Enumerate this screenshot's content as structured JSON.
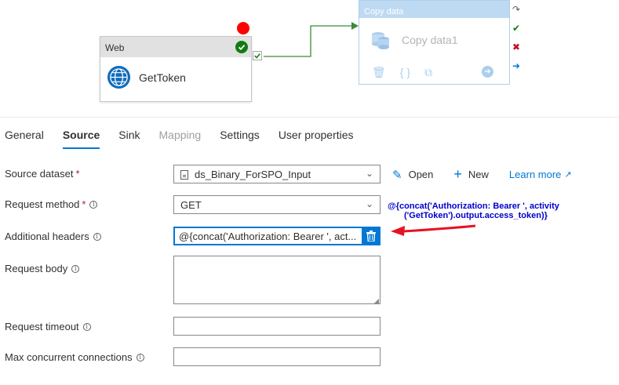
{
  "canvas": {
    "web_activity": {
      "type_label": "Web",
      "name": "GetToken"
    },
    "copy_activity": {
      "type_label": "Copy data",
      "name": "Copy data1"
    }
  },
  "tabs": [
    {
      "label": "General",
      "state": "normal"
    },
    {
      "label": "Source",
      "state": "active"
    },
    {
      "label": "Sink",
      "state": "normal"
    },
    {
      "label": "Mapping",
      "state": "disabled"
    },
    {
      "label": "Settings",
      "state": "normal"
    },
    {
      "label": "User properties",
      "state": "normal"
    }
  ],
  "form": {
    "source_dataset": {
      "label": "Source dataset",
      "required": "*",
      "value": "ds_Binary_ForSPO_Input"
    },
    "request_method": {
      "label": "Request method",
      "required": "*",
      "value": "GET"
    },
    "additional_headers": {
      "label": "Additional headers",
      "value": "@{concat('Authorization: Bearer ', act..."
    },
    "request_body": {
      "label": "Request body",
      "value": ""
    },
    "request_timeout": {
      "label": "Request timeout",
      "value": ""
    },
    "max_concurrent": {
      "label": "Max concurrent connections",
      "value": ""
    }
  },
  "actions": {
    "open": "Open",
    "new": "New",
    "learn_more": "Learn more"
  },
  "annotation": {
    "line1": "@{concat('Authorization: Bearer ', activity",
    "line2": "('GetToken').output.access_token)}"
  },
  "colors": {
    "accent": "#0078d4",
    "success": "#107c10",
    "annotation": "#0000cc",
    "arrow": "#e81123"
  }
}
